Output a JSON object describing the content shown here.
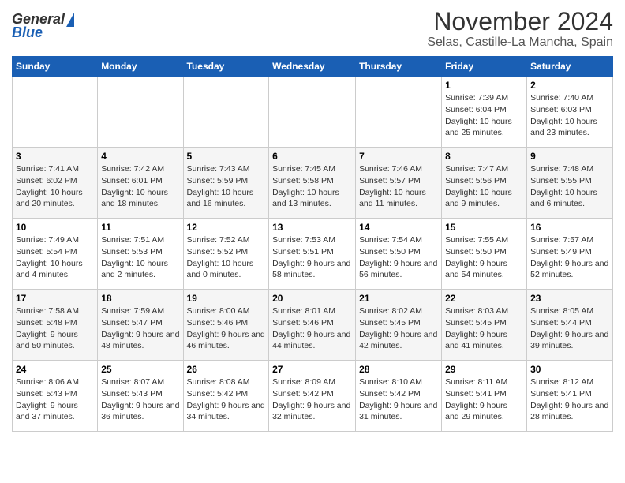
{
  "logo": {
    "general": "General",
    "blue": "Blue"
  },
  "title": "November 2024",
  "subtitle": "Selas, Castille-La Mancha, Spain",
  "calendar": {
    "headers": [
      "Sunday",
      "Monday",
      "Tuesday",
      "Wednesday",
      "Thursday",
      "Friday",
      "Saturday"
    ],
    "weeks": [
      [
        {
          "day": "",
          "info": ""
        },
        {
          "day": "",
          "info": ""
        },
        {
          "day": "",
          "info": ""
        },
        {
          "day": "",
          "info": ""
        },
        {
          "day": "",
          "info": ""
        },
        {
          "day": "1",
          "info": "Sunrise: 7:39 AM\nSunset: 6:04 PM\nDaylight: 10 hours and 25 minutes."
        },
        {
          "day": "2",
          "info": "Sunrise: 7:40 AM\nSunset: 6:03 PM\nDaylight: 10 hours and 23 minutes."
        }
      ],
      [
        {
          "day": "3",
          "info": "Sunrise: 7:41 AM\nSunset: 6:02 PM\nDaylight: 10 hours and 20 minutes."
        },
        {
          "day": "4",
          "info": "Sunrise: 7:42 AM\nSunset: 6:01 PM\nDaylight: 10 hours and 18 minutes."
        },
        {
          "day": "5",
          "info": "Sunrise: 7:43 AM\nSunset: 5:59 PM\nDaylight: 10 hours and 16 minutes."
        },
        {
          "day": "6",
          "info": "Sunrise: 7:45 AM\nSunset: 5:58 PM\nDaylight: 10 hours and 13 minutes."
        },
        {
          "day": "7",
          "info": "Sunrise: 7:46 AM\nSunset: 5:57 PM\nDaylight: 10 hours and 11 minutes."
        },
        {
          "day": "8",
          "info": "Sunrise: 7:47 AM\nSunset: 5:56 PM\nDaylight: 10 hours and 9 minutes."
        },
        {
          "day": "9",
          "info": "Sunrise: 7:48 AM\nSunset: 5:55 PM\nDaylight: 10 hours and 6 minutes."
        }
      ],
      [
        {
          "day": "10",
          "info": "Sunrise: 7:49 AM\nSunset: 5:54 PM\nDaylight: 10 hours and 4 minutes."
        },
        {
          "day": "11",
          "info": "Sunrise: 7:51 AM\nSunset: 5:53 PM\nDaylight: 10 hours and 2 minutes."
        },
        {
          "day": "12",
          "info": "Sunrise: 7:52 AM\nSunset: 5:52 PM\nDaylight: 10 hours and 0 minutes."
        },
        {
          "day": "13",
          "info": "Sunrise: 7:53 AM\nSunset: 5:51 PM\nDaylight: 9 hours and 58 minutes."
        },
        {
          "day": "14",
          "info": "Sunrise: 7:54 AM\nSunset: 5:50 PM\nDaylight: 9 hours and 56 minutes."
        },
        {
          "day": "15",
          "info": "Sunrise: 7:55 AM\nSunset: 5:50 PM\nDaylight: 9 hours and 54 minutes."
        },
        {
          "day": "16",
          "info": "Sunrise: 7:57 AM\nSunset: 5:49 PM\nDaylight: 9 hours and 52 minutes."
        }
      ],
      [
        {
          "day": "17",
          "info": "Sunrise: 7:58 AM\nSunset: 5:48 PM\nDaylight: 9 hours and 50 minutes."
        },
        {
          "day": "18",
          "info": "Sunrise: 7:59 AM\nSunset: 5:47 PM\nDaylight: 9 hours and 48 minutes."
        },
        {
          "day": "19",
          "info": "Sunrise: 8:00 AM\nSunset: 5:46 PM\nDaylight: 9 hours and 46 minutes."
        },
        {
          "day": "20",
          "info": "Sunrise: 8:01 AM\nSunset: 5:46 PM\nDaylight: 9 hours and 44 minutes."
        },
        {
          "day": "21",
          "info": "Sunrise: 8:02 AM\nSunset: 5:45 PM\nDaylight: 9 hours and 42 minutes."
        },
        {
          "day": "22",
          "info": "Sunrise: 8:03 AM\nSunset: 5:45 PM\nDaylight: 9 hours and 41 minutes."
        },
        {
          "day": "23",
          "info": "Sunrise: 8:05 AM\nSunset: 5:44 PM\nDaylight: 9 hours and 39 minutes."
        }
      ],
      [
        {
          "day": "24",
          "info": "Sunrise: 8:06 AM\nSunset: 5:43 PM\nDaylight: 9 hours and 37 minutes."
        },
        {
          "day": "25",
          "info": "Sunrise: 8:07 AM\nSunset: 5:43 PM\nDaylight: 9 hours and 36 minutes."
        },
        {
          "day": "26",
          "info": "Sunrise: 8:08 AM\nSunset: 5:42 PM\nDaylight: 9 hours and 34 minutes."
        },
        {
          "day": "27",
          "info": "Sunrise: 8:09 AM\nSunset: 5:42 PM\nDaylight: 9 hours and 32 minutes."
        },
        {
          "day": "28",
          "info": "Sunrise: 8:10 AM\nSunset: 5:42 PM\nDaylight: 9 hours and 31 minutes."
        },
        {
          "day": "29",
          "info": "Sunrise: 8:11 AM\nSunset: 5:41 PM\nDaylight: 9 hours and 29 minutes."
        },
        {
          "day": "30",
          "info": "Sunrise: 8:12 AM\nSunset: 5:41 PM\nDaylight: 9 hours and 28 minutes."
        }
      ]
    ]
  }
}
